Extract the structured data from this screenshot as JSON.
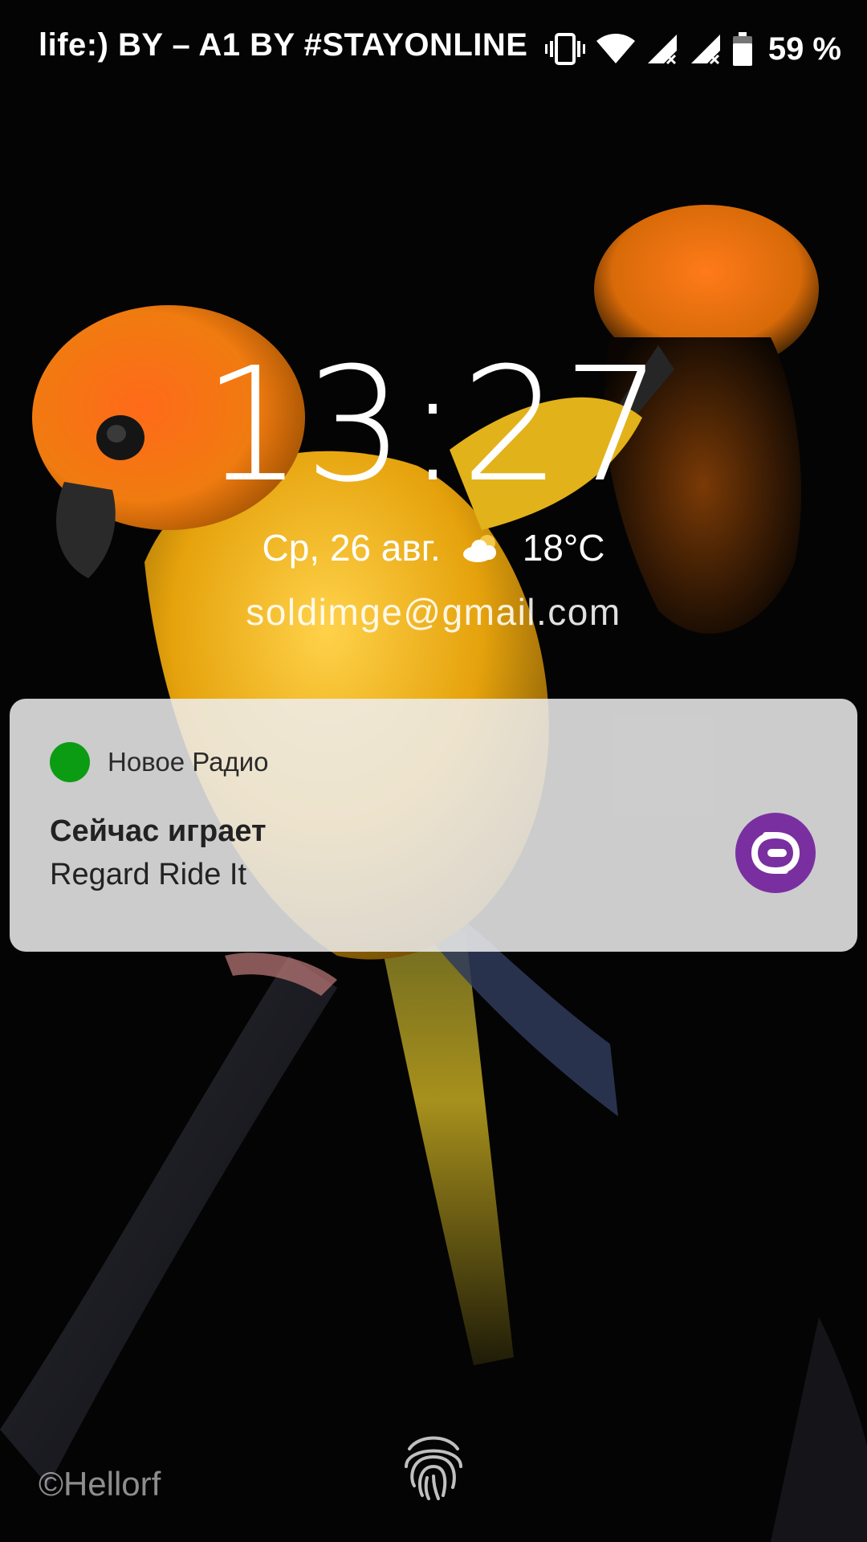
{
  "status_bar": {
    "carrier": "life:) BY – A1 BY #STAYONLINE",
    "battery_percent": "59 %",
    "icons": [
      "vibrate-icon",
      "wifi-icon",
      "signal-sim1-icon",
      "signal-sim2-icon",
      "battery-icon"
    ]
  },
  "lock_screen": {
    "time": "13:27",
    "date": "Ср, 26 авг.",
    "weather_icon": "partly-cloudy-icon",
    "temperature": "18°C",
    "owner_info": "soldimge@gmail.com"
  },
  "notification": {
    "app_name": "Новое Радио",
    "app_icon_color": "#0b9c14",
    "title": "Сейчас играет",
    "text": "Regard Ride It",
    "large_icon_color": "#7a2fa1"
  },
  "bottom": {
    "fingerprint_icon": "fingerprint-icon",
    "wallpaper_credit": "©Hellorf"
  }
}
